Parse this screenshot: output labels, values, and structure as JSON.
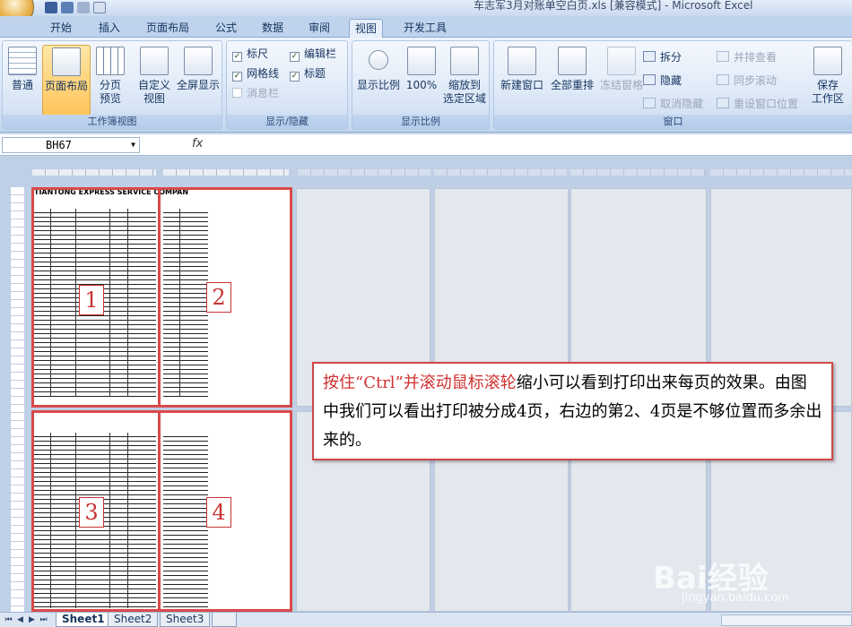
{
  "window": {
    "title": "车志军3月对账单空白页.xls  [兼容模式] - Microsoft Excel"
  },
  "tabs": [
    "开始",
    "插入",
    "页面布局",
    "公式",
    "数据",
    "审阅",
    "视图",
    "开发工具"
  ],
  "active_tab": "视图",
  "ribbon": {
    "workbook_views": {
      "label": "工作簿视图",
      "normal": "普通",
      "page_layout": "页面布局",
      "page_break": "分页\n预览",
      "custom": "自定义\n视图",
      "fullscreen": "全屏显示"
    },
    "show_hide": {
      "label": "显示/隐藏",
      "ruler": "标尺",
      "gridlines": "网格线",
      "messagebar": "消息栏",
      "formula_bar": "编辑栏",
      "headings": "标题"
    },
    "zoom": {
      "label": "显示比例",
      "zoom": "显示比例",
      "100": "100%",
      "zoom_selection": "缩放到\n选定区域"
    },
    "window": {
      "label": "窗口",
      "new_window": "新建窗口",
      "arrange_all": "全部重排",
      "freeze": "冻结窗格",
      "split": "拆分",
      "hide": "隐藏",
      "unhide": "取消隐藏",
      "side_by_side": "并排查看",
      "sync_scroll": "同步滚动",
      "reset_pos": "重设窗口位置",
      "save_ws": "保存\n工作区"
    }
  },
  "formula_bar": {
    "name_box": "BH67",
    "fx": "fx"
  },
  "sheet": {
    "header_text": "TIANTONG  EXPRESS  SERVICE  COMPAN",
    "page_numbers": [
      "1",
      "2",
      "3",
      "4"
    ],
    "callout_highlight": "按住“Ctrl”并滚动鼠标滚轮",
    "callout_text": "缩小可以看到打印出来每页的效果。由图中我们可以看出打印被分成4页，右边的第2、4页是不够位置而多余出来的。"
  },
  "sheet_tabs": [
    "Sheet1",
    "Sheet2",
    "Sheet3"
  ],
  "active_sheet": "Sheet1",
  "watermark": {
    "brand": "Bai经验",
    "url": "jingyan.baidu.com"
  }
}
